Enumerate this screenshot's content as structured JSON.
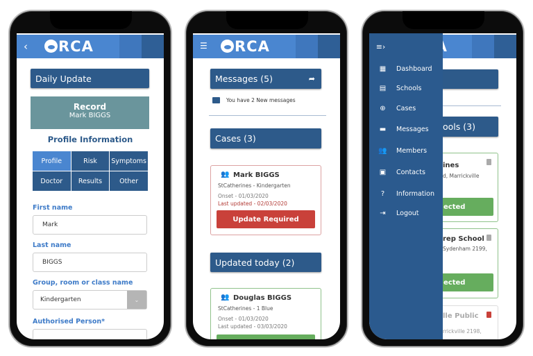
{
  "brand": {
    "logo": "ORCA",
    "primary": "#4a86d0",
    "dark": "#2d5a8a",
    "danger": "#c9413a",
    "success": "#66ad5e"
  },
  "phone1": {
    "back_icon": "chevron-left-icon",
    "title": "Daily Update",
    "record": {
      "title": "Record",
      "name": "Mark BIGGS"
    },
    "section": "Profile Information",
    "tabs": [
      {
        "label": "Profile",
        "active": true
      },
      {
        "label": "Risk"
      },
      {
        "label": "Symptoms"
      },
      {
        "label": "Doctor"
      },
      {
        "label": "Results"
      },
      {
        "label": "Other"
      }
    ],
    "fields": {
      "first_name_label": "First name",
      "first_name": "Mark",
      "last_name_label": "Last name",
      "last_name": "BIGGS",
      "group_label": "Group, room or class name",
      "group": "Kindergarten",
      "authorised_label": "Authorised Person*"
    }
  },
  "phone2": {
    "menu_icon": "hamburger-icon",
    "messages_title": "Messages (5)",
    "messages_note": "You have 2 New messages",
    "cases_title": "Cases (3)",
    "case": {
      "name": "Mark BIGGS",
      "group": "StCatherines - Kindergarten",
      "onset": "Onset  - 01/03/2020",
      "updated": "Last updated - 02/03/2020",
      "button": "Update Required"
    },
    "updated_title": "Updated today (2)",
    "case2": {
      "name": "Douglas BIGGS",
      "group": "StCatherines - 1 Blue",
      "onset": "Onset  - 01/03/2020",
      "updated": "Last updated - 03/03/2020"
    }
  },
  "phone3": {
    "menu": [
      {
        "label": "Dashboard",
        "icon": "dashboard-icon"
      },
      {
        "label": "Schools",
        "icon": "building-icon"
      },
      {
        "label": "Cases",
        "icon": "plus-circle-icon"
      },
      {
        "label": "Messages",
        "icon": "message-icon"
      },
      {
        "label": "Members",
        "icon": "people-icon"
      },
      {
        "label": "Contacts",
        "icon": "contact-card-icon"
      },
      {
        "label": "Information",
        "icon": "help-icon"
      },
      {
        "label": "Logout",
        "icon": "logout-icon"
      }
    ],
    "bg": {
      "schools_title": "ools (3)",
      "s1_name": "ines",
      "s1_addr": "d, Marrickville",
      "s1_btn": "ected",
      "s2_name": "rep School",
      "s2_addr": "Sydenham 2199,",
      "s2_btn": "ected",
      "s3_name": "lle Public",
      "s3_addr": "rrickville 2198,"
    }
  }
}
